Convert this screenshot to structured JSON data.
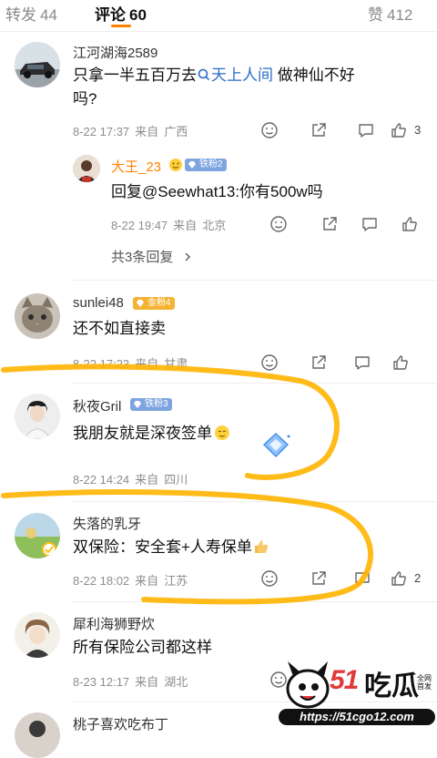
{
  "tabs": {
    "repost": {
      "label": "转发",
      "count": "44"
    },
    "comment": {
      "label": "评论",
      "count": "60"
    },
    "like": {
      "label": "赞",
      "count": "412"
    }
  },
  "comments": [
    {
      "user": "江河湖海2589",
      "text_pre": "只拿一半五百万去",
      "link": "天上人间",
      "text_post": " 做神仙不好",
      "text_line2": "吗?",
      "time": "8-22 17:37",
      "from_label": "来自",
      "location": "广西",
      "likes": "3",
      "reply": {
        "user": "大王_23",
        "badge": "铁粉2",
        "text": "回复@Seewhat13:你有500w吗",
        "time": "8-22 19:47",
        "from_label": "来自",
        "location": "北京"
      },
      "more_replies": "共3条回复"
    },
    {
      "user": "sunlei48",
      "badge": "金粉4",
      "text": "还不如直接卖",
      "time": "8-22 17:23",
      "from_label": "来自",
      "location": "甘肃"
    },
    {
      "user": "秋夜Gril",
      "badge": "铁粉3",
      "text": "我朋友就是深夜签单",
      "time": "8-22 14:24",
      "from_label": "来自",
      "location": "四川"
    },
    {
      "user": "失落的乳牙",
      "text": "双保险：安全套+人寿保单",
      "time": "8-22 18:02",
      "from_label": "来自",
      "location": "江苏",
      "likes": "2"
    },
    {
      "user": "犀利海狮野炊",
      "text": "所有保险公司都这样",
      "time": "8-23 12:17",
      "from_label": "来自",
      "location": "湖北"
    },
    {
      "user": "桃子喜欢吃布丁"
    }
  ],
  "watermark": {
    "brand": "吃瓜",
    "number": "51",
    "url": "https://51cgo12.com",
    "tag": "全网首发"
  },
  "colors": {
    "accent": "#ff8200",
    "link": "#2a6bc9",
    "annotation": "#ffb400"
  }
}
